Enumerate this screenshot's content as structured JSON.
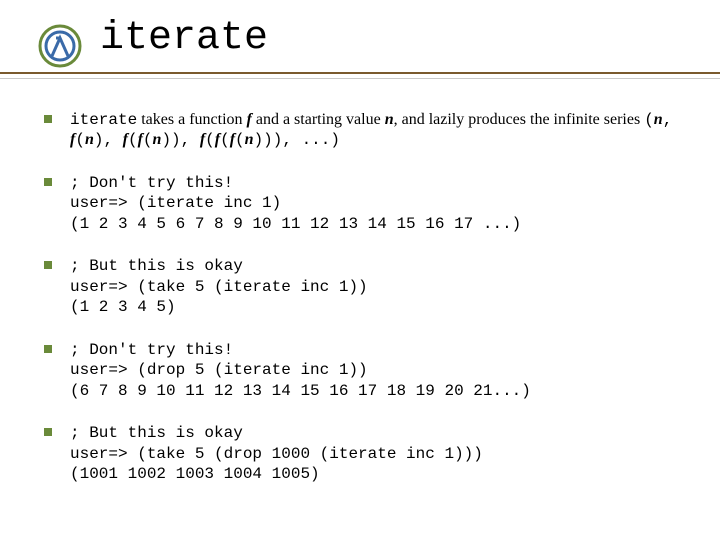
{
  "title": "iterate",
  "intro": {
    "func_word": "iterate",
    "text1": " takes a function ",
    "f1": "f",
    "text2": " and a starting value ",
    "n1": "n",
    "text3": ", and lazily produces the infinite series ",
    "series_open": "(",
    "n2": "n",
    "c1": ", ",
    "f2": "f",
    "p1": "(",
    "n3": "n",
    "p2": ")",
    "c2": ", ",
    "f3": "f",
    "p3": "(",
    "f4": "f",
    "p4": "(",
    "n4": "n",
    "p5": "))",
    "c3": ", ",
    "f5": "f",
    "p6": "(",
    "f6": "f",
    "p7": "(",
    "f7": "f",
    "p8": "(",
    "n5": "n",
    "p9": ")))",
    "c4": ", ...)"
  },
  "blocks": {
    "b1_l1": "; Don't try this!",
    "b1_l2": "user=> (iterate inc 1)",
    "b1_l3": "(1 2 3 4 5 6 7 8 9 10 11 12 13 14 15 16 17 ...)",
    "b2_l1": "; But this is okay",
    "b2_l2": "user=> (take 5 (iterate inc 1))",
    "b2_l3": "(1 2 3 4 5)",
    "b3_l1": "; Don't try this!",
    "b3_l2": "user=> (drop 5 (iterate inc 1))",
    "b3_l3": "(6 7 8 9 10 11 12 13 14 15 16 17 18 19 20 21...)",
    "b4_l1": "; But this is okay",
    "b4_l2": "user=> (take 5 (drop 1000 (iterate inc 1)))",
    "b4_l3": "(1001 1002 1003 1004 1005)"
  }
}
